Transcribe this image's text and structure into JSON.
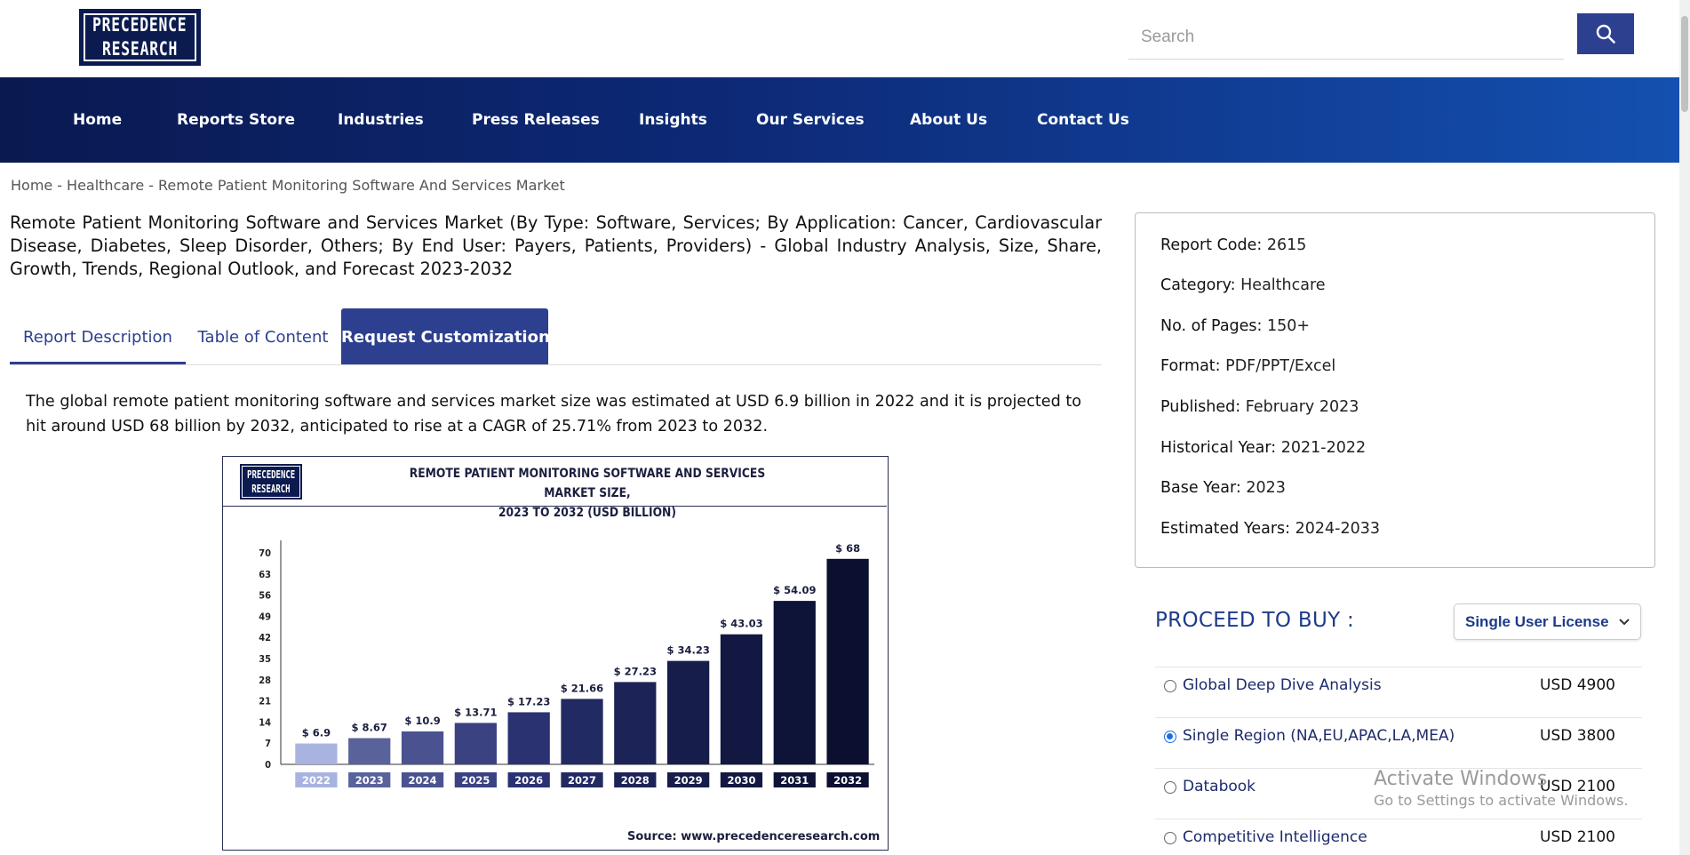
{
  "logo": {
    "line1": "PRECEDENCE",
    "line2": "RESEARCH"
  },
  "search": {
    "placeholder": "Search",
    "icon": "search-icon"
  },
  "nav": {
    "items": [
      "Home",
      "Reports Store",
      "Industries",
      "Press Releases",
      "Insights",
      "Our Services",
      "About Us",
      "Contact Us"
    ]
  },
  "breadcrumb": [
    "Home",
    "Healthcare",
    "Remote Patient Monitoring Software And Services Market"
  ],
  "breadcrumb_sep": "-",
  "page_title": "Remote Patient Monitoring Software and Services Market (By Type: Software, Services; By Application: Cancer, Cardiovascular Disease, Diabetes, Sleep Disorder, Others; By End User: Payers, Patients, Providers) - Global Industry Analysis, Size, Share, Growth, Trends, Regional Outlook, and Forecast 2023-2032",
  "tabs": {
    "description": "Report Description",
    "toc": "Table of Content",
    "customization": "Request Customization"
  },
  "summary": "The global remote patient monitoring software and services market size was estimated at USD 6.9 billion in 2022 and it is projected to hit around USD 68 billion by 2032, anticipated to rise at a CAGR of 25.71% from 2023 to 2032.",
  "infographic": {
    "logo_line1": "PRECEDENCE",
    "logo_line2": "RESEARCH",
    "title_line1": "REMOTE PATIENT MONITORING SOFTWARE AND SERVICES MARKET SIZE,",
    "title_line2": "2023 TO 2032 (USD BILLION)",
    "source": "Source: www.precedenceresearch.com"
  },
  "chart_data": {
    "type": "bar",
    "title": "REMOTE PATIENT MONITORING SOFTWARE AND SERVICES MARKET SIZE, 2023 TO 2032 (USD BILLION)",
    "categories": [
      "2022",
      "2023",
      "2024",
      "2025",
      "2026",
      "2027",
      "2028",
      "2029",
      "2030",
      "2031",
      "2032"
    ],
    "values": [
      6.9,
      8.67,
      10.9,
      13.71,
      17.23,
      21.66,
      27.23,
      34.23,
      43.03,
      54.09,
      68
    ],
    "data_labels": [
      "$ 6.9",
      "$ 8.67",
      "$ 10.9",
      "$ 13.71",
      "$ 17.23",
      "$ 21.66",
      "$ 27.23",
      "$ 34.23",
      "$ 43.03",
      "$ 54.09",
      "$ 68"
    ],
    "yticks": [
      0,
      7,
      14,
      21,
      28,
      35,
      42,
      49,
      56,
      63,
      70
    ],
    "ylim": [
      0,
      70
    ],
    "xlabel": "",
    "ylabel": "",
    "grid": false,
    "colors": [
      "#a9b3df",
      "#59629a",
      "#4a5390",
      "#3a4282",
      "#2b3272",
      "#222a63",
      "#1c2356",
      "#161d4b",
      "#121841",
      "#0e1438",
      "#0b1030"
    ]
  },
  "report_info": [
    {
      "label": "Report Code:",
      "value": "2615"
    },
    {
      "label": "Category:",
      "value": "Healthcare"
    },
    {
      "label": "No. of Pages:",
      "value": "150+"
    },
    {
      "label": "Format:",
      "value": "PDF/PPT/Excel"
    },
    {
      "label": "Published:",
      "value": "February 2023"
    },
    {
      "label": "Historical Year:",
      "value": "2021-2022"
    },
    {
      "label": "Base Year:",
      "value": "2023"
    },
    {
      "label": "Estimated Years:",
      "value": "2024-2033"
    }
  ],
  "buy": {
    "title": "PROCEED TO BUY :",
    "license_selected": "Single User License",
    "options": [
      {
        "name": "Global Deep Dive Analysis",
        "price": "USD 4900",
        "selected": false
      },
      {
        "name": "Single Region (NA,EU,APAC,LA,MEA)",
        "price": "USD 3800",
        "selected": true
      },
      {
        "name": "Databook",
        "price": "USD 2100",
        "selected": false
      },
      {
        "name": "Competitive Intelligence",
        "price": "USD 2100",
        "selected": false
      }
    ]
  },
  "watermark": {
    "line1": "Activate Windows",
    "line2": "Go to Settings to activate Windows."
  },
  "colors": {
    "brand": "#2d3f8f",
    "nav_start": "#0a1950",
    "nav_end": "#1450b0",
    "accent_text": "#1d3b8a"
  }
}
